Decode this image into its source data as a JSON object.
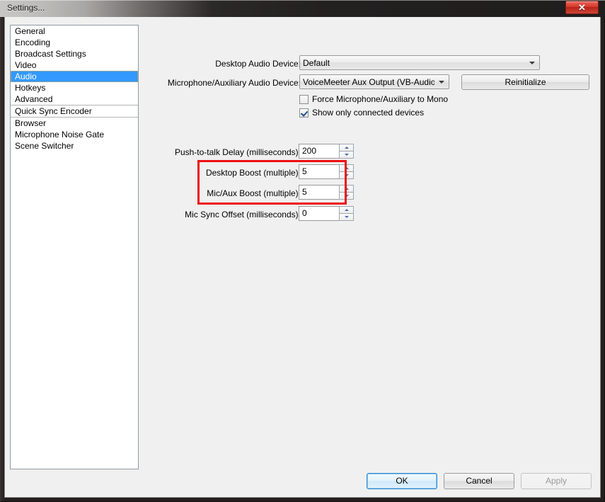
{
  "window": {
    "title": "Settings...",
    "close_label": "✕"
  },
  "sidebar": {
    "items": [
      {
        "label": "General",
        "selected": false,
        "separator_after": false
      },
      {
        "label": "Encoding",
        "selected": false,
        "separator_after": false
      },
      {
        "label": "Broadcast Settings",
        "selected": false,
        "separator_after": false
      },
      {
        "label": "Video",
        "selected": false,
        "separator_after": false
      },
      {
        "label": "Audio",
        "selected": true,
        "separator_after": false
      },
      {
        "label": "Hotkeys",
        "selected": false,
        "separator_after": false
      },
      {
        "label": "Advanced",
        "selected": false,
        "separator_after": true
      },
      {
        "label": "Quick Sync Encoder",
        "selected": false,
        "separator_after": true
      },
      {
        "label": "Browser",
        "selected": false,
        "separator_after": false
      },
      {
        "label": "Microphone Noise Gate",
        "selected": false,
        "separator_after": false
      },
      {
        "label": "Scene Switcher",
        "selected": false,
        "separator_after": false
      }
    ]
  },
  "audio_panel": {
    "desktop_device": {
      "label": "Desktop Audio Device:",
      "value": "Default"
    },
    "mic_device": {
      "label": "Microphone/Auxiliary Audio Device:",
      "value": "VoiceMeeter Aux Output (VB-Audio Voicel"
    },
    "reinitialize_label": "Reinitialize",
    "checkboxes": [
      {
        "label": "Force Microphone/Auxiliary to Mono",
        "checked": false
      },
      {
        "label": "Show only connected devices",
        "checked": true
      }
    ],
    "spinners": [
      {
        "label": "Push-to-talk Delay (milliseconds):",
        "value": "200"
      },
      {
        "label": "Desktop Boost (multiple):",
        "value": "5"
      },
      {
        "label": "Mic/Aux Boost (multiple):",
        "value": "5"
      },
      {
        "label": "Mic Sync Offset (milliseconds):",
        "value": "0"
      }
    ]
  },
  "annotation": {
    "color": "#ee1111"
  },
  "footer": {
    "ok_label": "OK",
    "cancel_label": "Cancel",
    "apply_label": "Apply"
  }
}
